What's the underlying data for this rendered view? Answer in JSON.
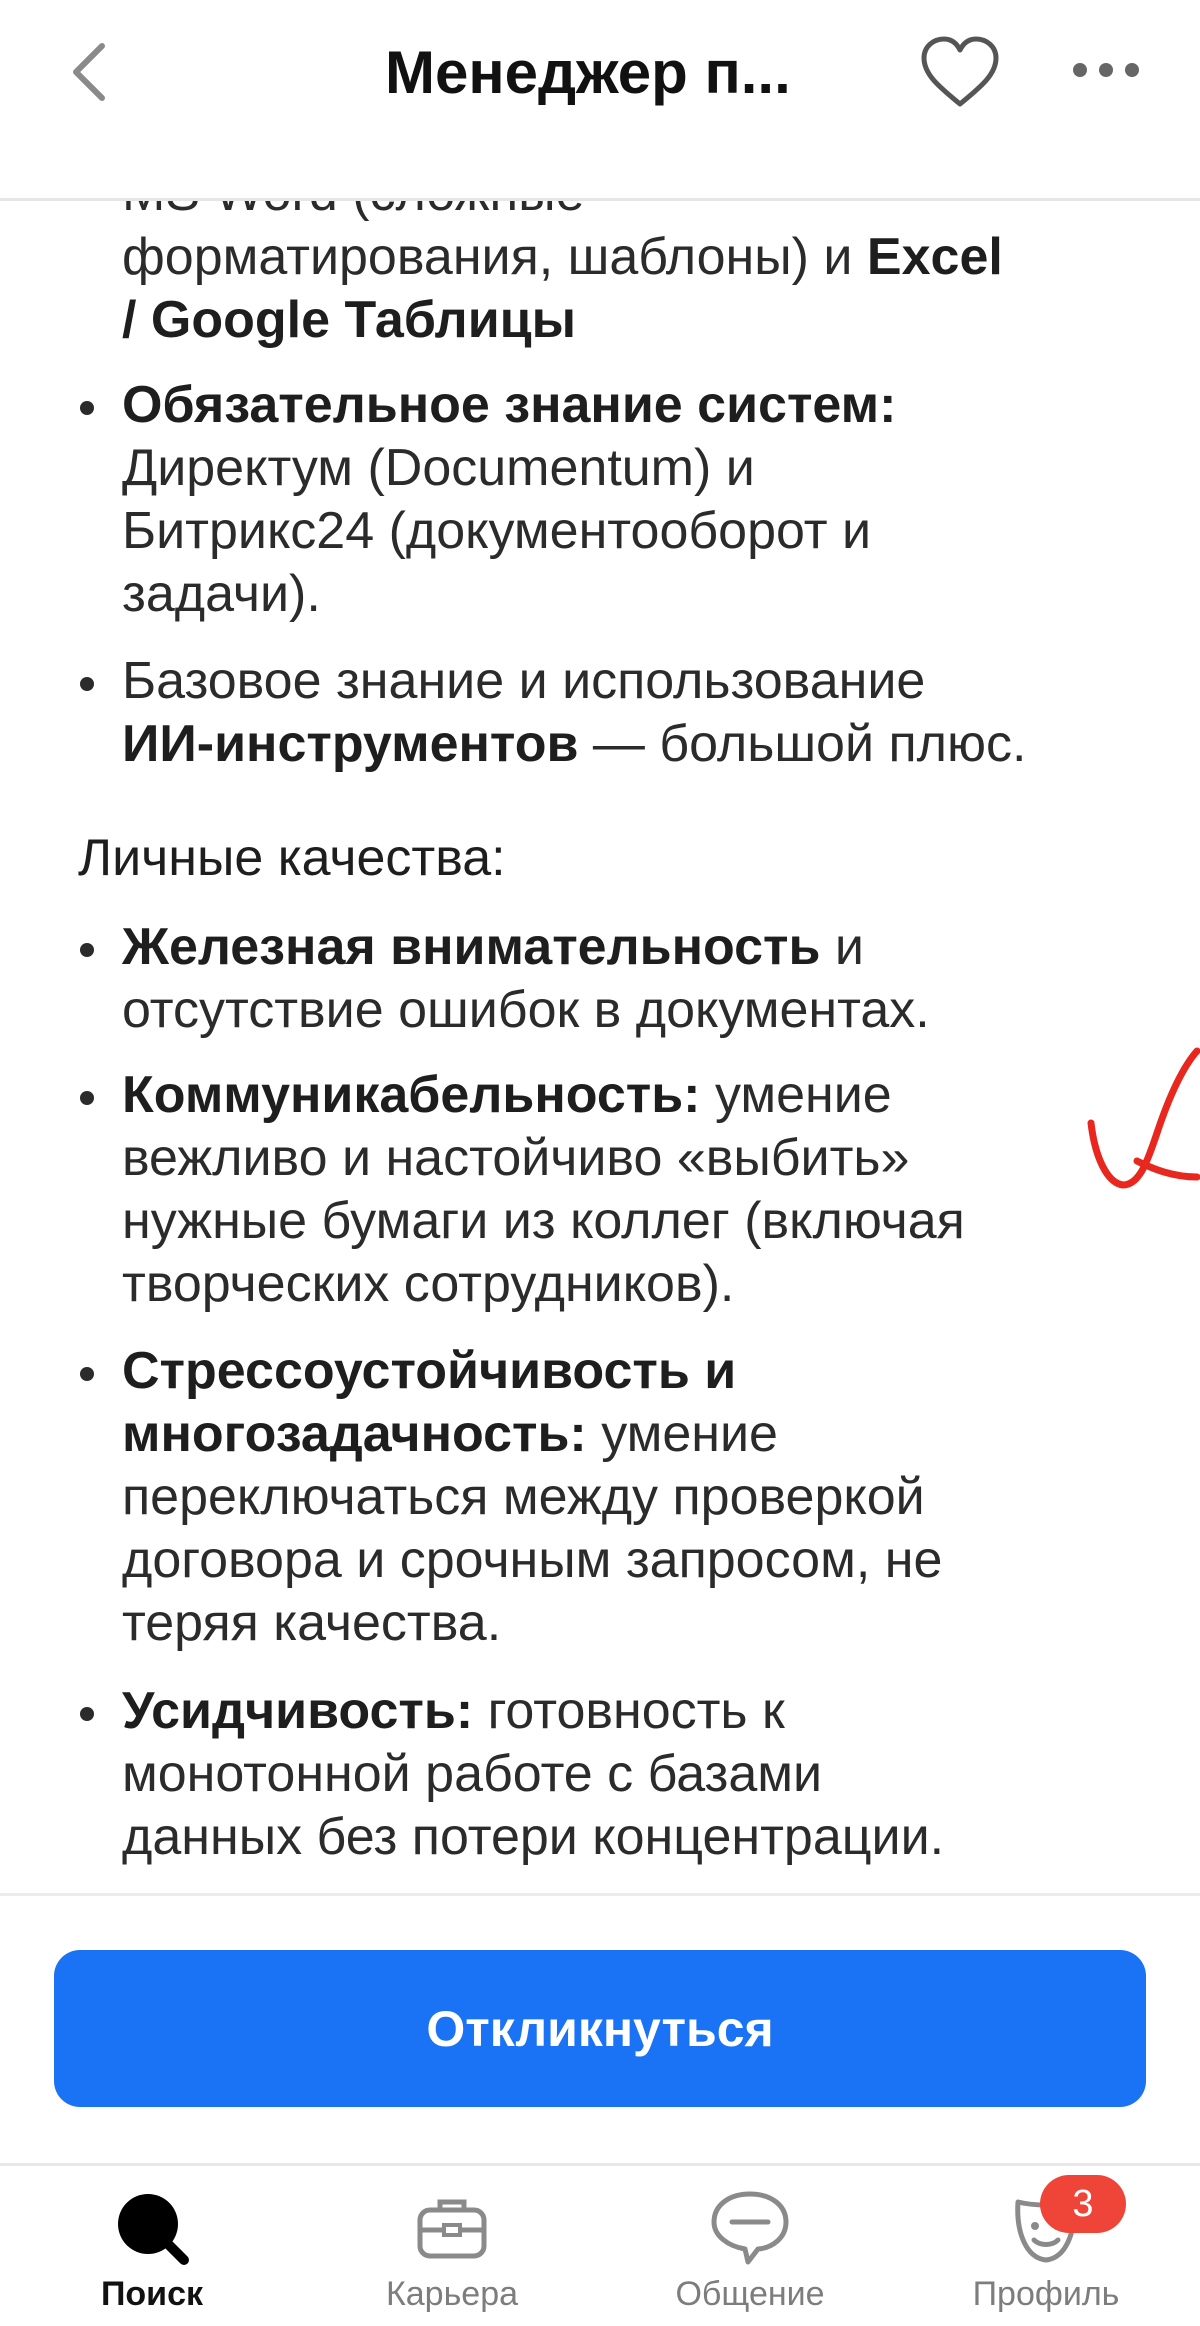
{
  "header": {
    "title": "Менеджер п..."
  },
  "content": {
    "cut_line": "MS Word (сложные",
    "lines_1": [
      "форматирования, шаблоны) и",
      "Excel",
      "/ Google Таблицы"
    ],
    "bullets": [
      {
        "lines": [
          {
            "bold": "Обязательное знание систем:",
            "text": ""
          },
          {
            "bold": "",
            "text": "Директум (Documentum) и"
          },
          {
            "bold": "",
            "text": "Битрикс24 (документооборот и"
          },
          {
            "bold": "",
            "text": "задачи)."
          }
        ]
      },
      {
        "lines": [
          {
            "bold": "",
            "text": "Базовое знание и использование"
          },
          {
            "bold": "ИИ-инструментов",
            "text": " — большой плюс."
          }
        ]
      }
    ],
    "section_heading": "Личные качества:",
    "quality_bullets": [
      {
        "lines": [
          {
            "bold": "Железная внимательность",
            "text": " и"
          },
          {
            "bold": "",
            "text": "отсутствие ошибок в документах."
          }
        ]
      },
      {
        "lines": [
          {
            "bold": "Коммуникабельность:",
            "text": " умение"
          },
          {
            "bold": "",
            "text": "вежливо и настойчиво «выбить»"
          },
          {
            "bold": "",
            "text": "нужные бумаги из коллег (включая"
          },
          {
            "bold": "",
            "text": "творческих сотрудников)."
          }
        ]
      },
      {
        "lines": [
          {
            "bold": "Стрессоустойчивость и",
            "text": ""
          },
          {
            "bold": "многозадачность:",
            "text": " умение"
          },
          {
            "bold": "",
            "text": "переключаться между проверкой"
          },
          {
            "bold": "",
            "text": "договора и срочным запросом, не"
          },
          {
            "bold": "",
            "text": "теряя качества."
          }
        ]
      },
      {
        "lines": [
          {
            "bold": "Усидчивость:",
            "text": " готовность к"
          },
          {
            "bold": "",
            "text": "монотонной работе с базами"
          },
          {
            "bold": "",
            "text": "данных без потери концентрации."
          }
        ]
      }
    ]
  },
  "respond_button": {
    "label": "Откликнуться",
    "color": "#1a73f4"
  },
  "bottom_nav": {
    "items": [
      {
        "label": "Поиск",
        "icon": "search-icon",
        "active": true
      },
      {
        "label": "Карьера",
        "icon": "briefcase-icon",
        "active": false
      },
      {
        "label": "Общение",
        "icon": "chat-icon",
        "active": false
      },
      {
        "label": "Профиль",
        "icon": "profile-mask-icon",
        "active": false
      }
    ],
    "badge_count": "3"
  },
  "annotation": {
    "icon": "handwritten-check-mark",
    "color": "#e8281e"
  }
}
